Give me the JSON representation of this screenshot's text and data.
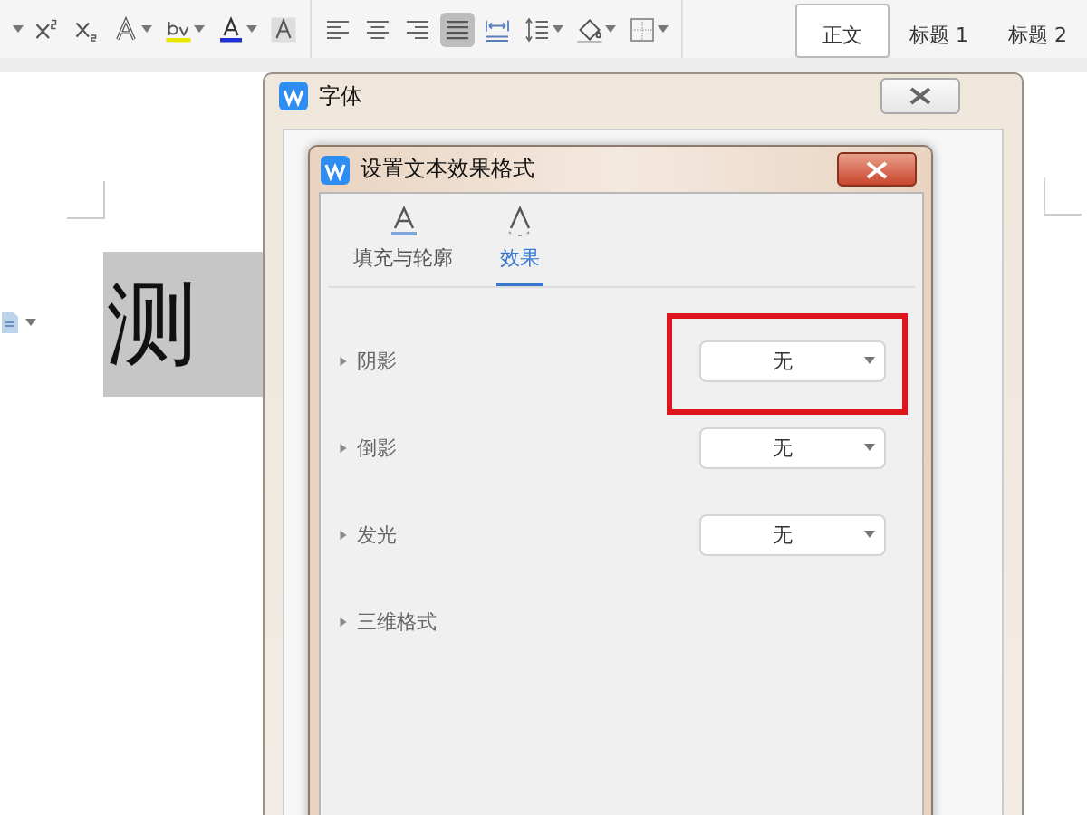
{
  "toolbar": {
    "font_tools": [
      {
        "kind": "superscript"
      },
      {
        "kind": "subscript"
      },
      {
        "kind": "text-effect"
      },
      {
        "kind": "highlight"
      },
      {
        "kind": "font-color"
      },
      {
        "kind": "char-shading"
      }
    ],
    "paragraph_tools": [
      {
        "kind": "align-left",
        "selected": false
      },
      {
        "kind": "align-center",
        "selected": false
      },
      {
        "kind": "align-right",
        "selected": false
      },
      {
        "kind": "justify",
        "selected": true
      },
      {
        "kind": "distribute",
        "selected": false
      },
      {
        "kind": "line-spacing",
        "selected": false
      },
      {
        "kind": "shading",
        "selected": false
      },
      {
        "kind": "borders",
        "selected": false
      }
    ],
    "styles": [
      {
        "label": "正文",
        "selected": true
      },
      {
        "label": "标题 1",
        "selected": false
      },
      {
        "label": "标题 2",
        "selected": false
      }
    ]
  },
  "document": {
    "text": "测"
  },
  "font_dialog": {
    "title": "字体"
  },
  "effects_dialog": {
    "title": "设置文本效果格式",
    "tabs": [
      {
        "label": "填充与轮廓",
        "selected": false
      },
      {
        "label": "效果",
        "selected": true
      }
    ],
    "sections": [
      {
        "label": "阴影",
        "expanded": false,
        "value": "无",
        "highlighted": true
      },
      {
        "label": "倒影",
        "expanded": false,
        "value": "无",
        "highlighted": false
      },
      {
        "label": "发光",
        "expanded": false,
        "value": "无",
        "highlighted": false
      },
      {
        "label": "三维格式",
        "expanded": false,
        "highlighted": false
      }
    ]
  }
}
